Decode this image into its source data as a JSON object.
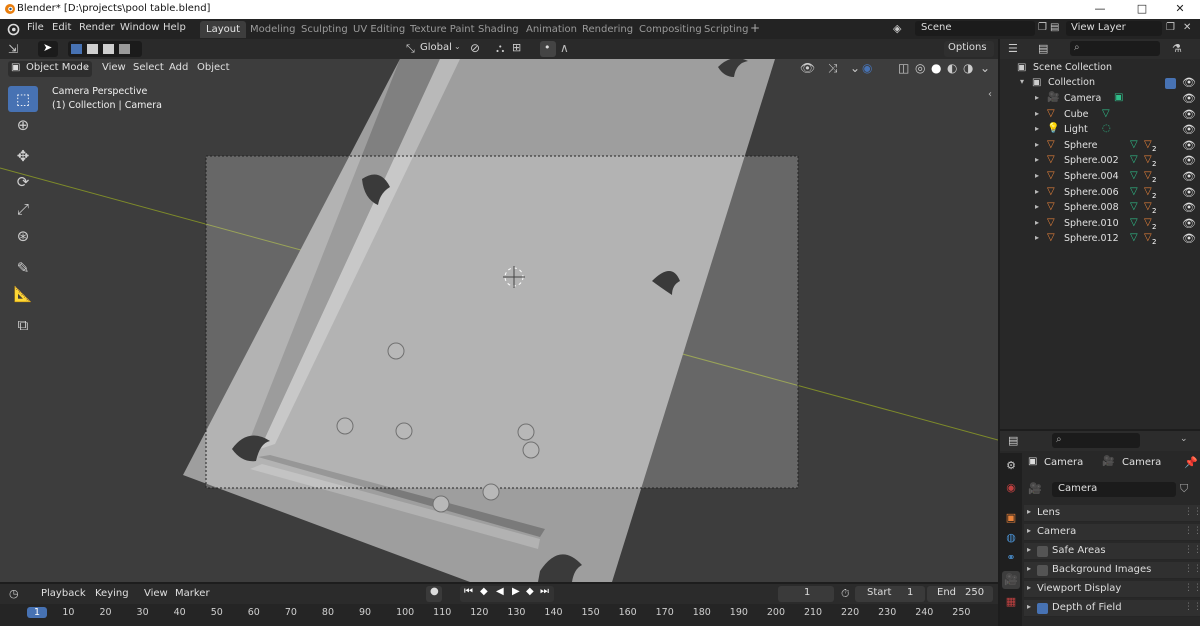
{
  "window": {
    "title": "Blender* [D:\\projects\\pool table.blend]",
    "minimize": "—",
    "maximize": "□",
    "close": "✕"
  },
  "menu": [
    "File",
    "Edit",
    "Render",
    "Window",
    "Help"
  ],
  "workspaces": [
    "Layout",
    "Modeling",
    "Sculpting",
    "UV Editing",
    "Texture Paint",
    "Shading",
    "Animation",
    "Rendering",
    "Compositing",
    "Scripting"
  ],
  "workspace_add": "+",
  "scene": {
    "name": "Scene",
    "view_layer": "View Layer"
  },
  "viewport_header": {
    "transform_orientation": "Global",
    "options": "Options",
    "mode": "Object Mode",
    "menus": [
      "View",
      "Select",
      "Add",
      "Object"
    ]
  },
  "viewport": {
    "camera_label": "Camera Perspective",
    "collection_label": "(1) Collection | Camera"
  },
  "outliner": {
    "root": "Scene Collection",
    "collection": "Collection",
    "items": [
      {
        "name": "Camera",
        "type": "camera"
      },
      {
        "name": "Cube",
        "type": "mesh"
      },
      {
        "name": "Light",
        "type": "light"
      },
      {
        "name": "Sphere",
        "type": "mesh",
        "badge": "2"
      },
      {
        "name": "Sphere.002",
        "type": "mesh",
        "badge": "2"
      },
      {
        "name": "Sphere.004",
        "type": "mesh",
        "badge": "2"
      },
      {
        "name": "Sphere.006",
        "type": "mesh",
        "badge": "2"
      },
      {
        "name": "Sphere.008",
        "type": "mesh",
        "badge": "2"
      },
      {
        "name": "Sphere.010",
        "type": "mesh",
        "badge": "2"
      },
      {
        "name": "Sphere.012",
        "type": "mesh",
        "badge": "2"
      }
    ]
  },
  "properties": {
    "breadcrumb_object": "Camera",
    "breadcrumb_data": "Camera",
    "datablock": "Camera",
    "panels": [
      {
        "label": "Lens",
        "checkbox": null
      },
      {
        "label": "Camera",
        "checkbox": null
      },
      {
        "label": "Safe Areas",
        "checkbox": false
      },
      {
        "label": "Background Images",
        "checkbox": false
      },
      {
        "label": "Viewport Display",
        "checkbox": null
      },
      {
        "label": "Depth of Field",
        "checkbox": true
      }
    ]
  },
  "timeline": {
    "menus": [
      "Playback",
      "Keying",
      "View",
      "Marker"
    ],
    "current_frame": "1",
    "start_label": "Start",
    "start": "1",
    "end_label": "End",
    "end": "250",
    "ruler": [
      "1",
      "10",
      "20",
      "30",
      "40",
      "50",
      "60",
      "70",
      "80",
      "90",
      "100",
      "110",
      "120",
      "130",
      "140",
      "150",
      "160",
      "170",
      "180",
      "190",
      "200",
      "210",
      "220",
      "230",
      "240",
      "250"
    ]
  },
  "colors": {
    "accent": "#4772b3",
    "mesh_icon": "#e8823a",
    "data_icon": "#2fbf8a"
  }
}
